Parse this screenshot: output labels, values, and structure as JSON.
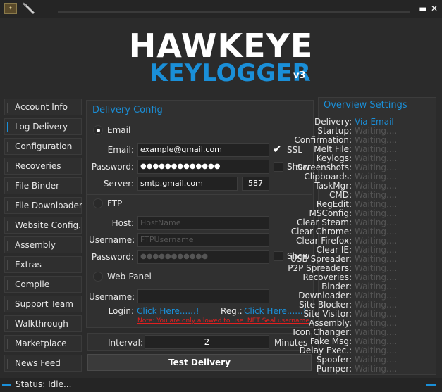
{
  "app": {
    "title_main": "HAWKEYE",
    "title_sub": "KEYLOGGER",
    "version": "v3"
  },
  "sidebar": {
    "items": [
      {
        "label": "Account Info"
      },
      {
        "label": "Log Delivery"
      },
      {
        "label": "Configuration"
      },
      {
        "label": "Recoveries"
      },
      {
        "label": "File Binder"
      },
      {
        "label": "File Downloader"
      },
      {
        "label": "Website Config."
      },
      {
        "label": "Assembly"
      },
      {
        "label": "Extras"
      },
      {
        "label": "Compile"
      },
      {
        "label": "Support Team"
      },
      {
        "label": "Walkthrough"
      },
      {
        "label": "Marketplace"
      },
      {
        "label": "News Feed"
      }
    ]
  },
  "delivery": {
    "title": "Delivery Config",
    "email_option": "Email",
    "email_label": "Email:",
    "email_value": "example@gmail.com",
    "ssl_label": "SSL",
    "password_label": "Password:",
    "password_value": "●●●●●●●●●●●●●",
    "show_label": "Show",
    "server_label": "Server:",
    "server_value": "smtp.gmail.com",
    "port_value": "587",
    "ftp_option": "FTP",
    "host_label": "Host:",
    "host_placeholder": "HostName",
    "username_label": "Username:",
    "ftp_user_placeholder": "FTPUsername",
    "ftp_password_label": "Password:",
    "ftp_password_value": "●●●●●●●●●●●",
    "ftp_show_label": "Show",
    "webpanel_option": "Web-Panel",
    "wp_username_label": "Username:",
    "login_label": "Login:",
    "login_link": "Click Here......!",
    "reg_label": "Reg.:",
    "reg_link": "Click Here......!",
    "note": "Note: You are only allowed to use .NET Seal username",
    "interval_label": "Interval:",
    "interval_value": "2",
    "minutes_label": "Minutes",
    "test_button": "Test Delivery"
  },
  "overview": {
    "title": "Overview Settings",
    "rows": [
      {
        "key": "Delivery:",
        "value": "Via Email"
      },
      {
        "key": "Startup:",
        "value": "Waiting...."
      },
      {
        "key": "Confirmation:",
        "value": "Waiting...."
      },
      {
        "key": "Melt File:",
        "value": "Waiting...."
      },
      {
        "key": "Keylogs:",
        "value": "Waiting...."
      },
      {
        "key": "Screenshots:",
        "value": "Waiting...."
      },
      {
        "key": "Clipboards:",
        "value": "Waiting...."
      },
      {
        "key": "TaskMgr:",
        "value": "Waiting...."
      },
      {
        "key": "CMD:",
        "value": "Waiting...."
      },
      {
        "key": "RegEdit:",
        "value": "Waiting...."
      },
      {
        "key": "MSConfig:",
        "value": "Waiting...."
      },
      {
        "key": "Clear Steam:",
        "value": "Waiting...."
      },
      {
        "key": "Clear Chrome:",
        "value": "Waiting...."
      },
      {
        "key": "Clear Firefox:",
        "value": "Waiting...."
      },
      {
        "key": "Clear IE:",
        "value": "Waiting...."
      },
      {
        "key": "USB Spreader:",
        "value": "Waiting...."
      },
      {
        "key": "P2P Spreaders:",
        "value": "Waiting...."
      },
      {
        "key": "Recoveries:",
        "value": "Waiting...."
      },
      {
        "key": "Binder:",
        "value": "Waiting...."
      },
      {
        "key": "Downloader:",
        "value": "Waiting...."
      },
      {
        "key": "Site Blocker:",
        "value": "Waiting...."
      },
      {
        "key": "Site Visitor:",
        "value": "Waiting...."
      },
      {
        "key": "Assembly:",
        "value": "Waiting...."
      },
      {
        "key": "Icon Changer:",
        "value": "Waiting...."
      },
      {
        "key": "Fake Msg:",
        "value": "Waiting...."
      },
      {
        "key": "Delay Exec.:",
        "value": "Waiting...."
      },
      {
        "key": "Spoofer:",
        "value": "Waiting...."
      },
      {
        "key": "Pumper:",
        "value": "Waiting...."
      }
    ]
  },
  "status": {
    "text": "Status: Idle..."
  },
  "colors": {
    "accent": "#1a8fd8",
    "background": "#2b2b2b",
    "note_red": "#e02020"
  }
}
